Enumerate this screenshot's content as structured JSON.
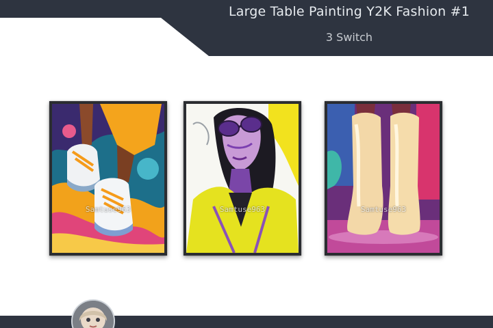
{
  "header": {
    "title": "Large Table Painting Y2K Fashion #1",
    "subtitle": "3 Switch",
    "banner_color": "#2e3440"
  },
  "paintings": [
    {
      "subject": "sneakers-painting",
      "watermark": "Samtuse963"
    },
    {
      "subject": "woman-sunglasses-painting",
      "watermark": "Samtuse963"
    },
    {
      "subject": "boots-painting",
      "watermark": "Samtuse963"
    }
  ],
  "footer": {
    "avatar": "doll-avatar-icon",
    "bar_color": "#2e3440"
  }
}
